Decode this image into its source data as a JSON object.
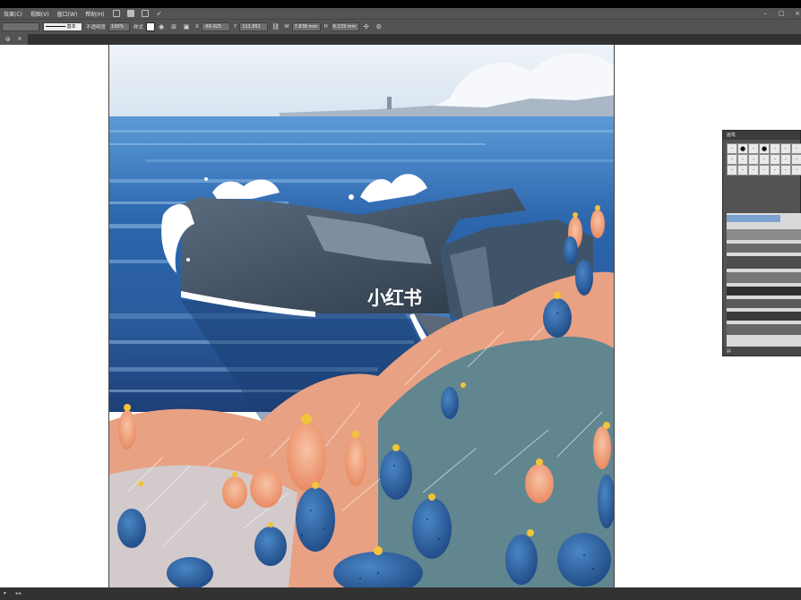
{
  "menubar": {
    "items": [
      "效果(C)",
      "视图(V)",
      "窗口(W)",
      "帮助(H)"
    ]
  },
  "controlbar": {
    "selection_label": "",
    "stroke_label": "基本",
    "opacity_label": "不透明度",
    "opacity_value": "100%",
    "style_label": "样式",
    "x_label": "X",
    "x_value": "-69.025",
    "y_label": "Y",
    "y_value": "111.651",
    "w_label": "W",
    "w_value": "7.838 mm",
    "h_label": "H",
    "h_value": "6.133 mm"
  },
  "tabbar": {
    "doc_label": "@"
  },
  "watermark": {
    "text": "小红书"
  },
  "brush_panel": {
    "title": "画笔",
    "cells": [
      "·",
      "●",
      "·",
      "●",
      "·",
      "·",
      "·",
      "·",
      "·",
      "·",
      "·",
      "·",
      "·",
      "·",
      "·",
      "·",
      "·",
      "·",
      "·",
      "·",
      "·"
    ]
  },
  "colors": {
    "ui_dark": "#535353",
    "ui_darker": "#323232",
    "sky": "#dfe9f3",
    "sea_deep": "#1f4f8d",
    "sea_light": "#4f8ed4",
    "rock": "#3d4d5f",
    "coral": "#f2a07b",
    "cactus": "#2b5d9c",
    "flower": "#f3c33a"
  }
}
